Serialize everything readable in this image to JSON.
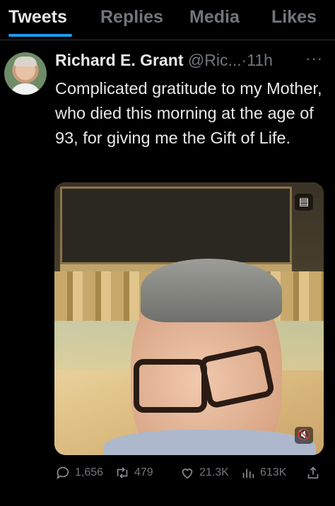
{
  "tabs": [
    {
      "label": "Tweets",
      "active": true
    },
    {
      "label": "Replies",
      "active": false
    },
    {
      "label": "Media",
      "active": false
    },
    {
      "label": "Likes",
      "active": false
    }
  ],
  "tweet": {
    "author_name": "Richard E. Grant",
    "handle": "@Ric...",
    "separator": "·",
    "time": "11h",
    "more_icon": "more-horizontal-icon",
    "text": "Complicated gratitude to my Mother, who died this morning at the age of 93, for giving me the Gift of Life.",
    "video_controls": {
      "captions_icon": "captions-icon",
      "mute_icon": "muted-speaker-icon"
    },
    "actions": {
      "replies": "1,656",
      "retweets": "479",
      "likes": "21.3K",
      "views": "613K"
    }
  },
  "colors": {
    "background": "#000000",
    "text": "#e7e9ea",
    "muted": "#71767b",
    "accent": "#1d9bf0"
  }
}
